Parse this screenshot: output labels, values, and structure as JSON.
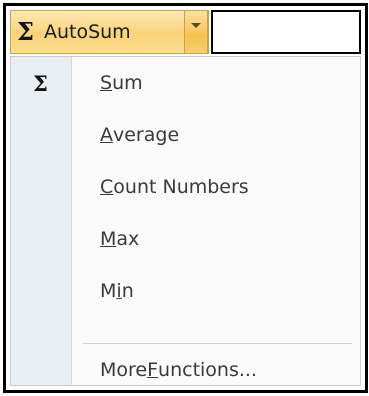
{
  "toolbar": {
    "autosum_icon": "sigma-icon",
    "autosum_label": "AutoSum",
    "dropdown_icon": "chevron-down-icon"
  },
  "menu": {
    "gutter_icon": "sigma-icon",
    "items": [
      {
        "label": "Sum",
        "accel": "S",
        "rest": "um"
      },
      {
        "label": "Average",
        "accel": "A",
        "rest": "verage"
      },
      {
        "label": "Count Numbers",
        "accel": "C",
        "rest": "ount Numbers"
      },
      {
        "label": "Max",
        "accel": "M",
        "rest": "ax"
      },
      {
        "label": "Min",
        "pre": "M",
        "accel": "i",
        "rest": "n"
      },
      {
        "label": "More Functions...",
        "pre": "More ",
        "accel": "F",
        "rest": "unctions..."
      }
    ]
  },
  "colors": {
    "button_highlight": "#f9d37a",
    "gutter": "#e9eef3",
    "menu_background": "#fafafa",
    "text": "#3a3a3a"
  }
}
